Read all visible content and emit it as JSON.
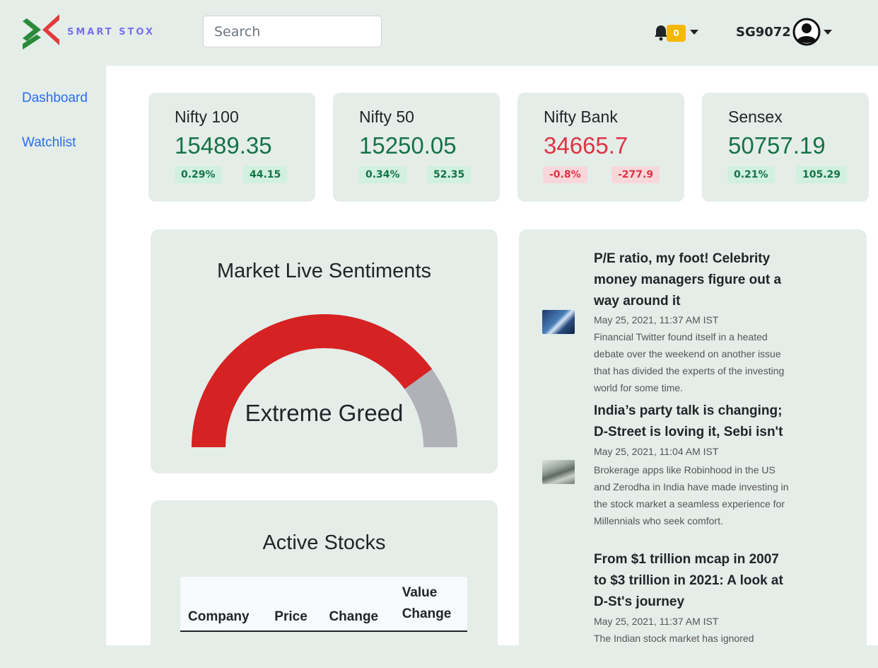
{
  "brand": {
    "name": "SMART STOX"
  },
  "search": {
    "placeholder": "Search"
  },
  "notifications": {
    "count": "0"
  },
  "user": {
    "name": "SG9072"
  },
  "sidebar": {
    "items": [
      {
        "label": "Dashboard"
      },
      {
        "label": "Watchlist"
      }
    ]
  },
  "indices": [
    {
      "name": "Nifty 100",
      "value": "15489.35",
      "change_pct": "0.29%",
      "change": "44.15",
      "direction": "up"
    },
    {
      "name": "Nifty 50",
      "value": "15250.05",
      "change_pct": "0.34%",
      "change": "52.35",
      "direction": "up"
    },
    {
      "name": "Nifty Bank",
      "value": "34665.7",
      "change_pct": "-0.8%",
      "change": "-277.9",
      "direction": "down"
    },
    {
      "name": "Sensex",
      "value": "50757.19",
      "change_pct": "0.21%",
      "change": "105.29",
      "direction": "up"
    }
  ],
  "sentiment": {
    "title": "Market Live Sentiments",
    "label": "Extreme Greed",
    "level": 0.8
  },
  "active_stocks": {
    "title": "Active Stocks",
    "columns": [
      "Company",
      "Price",
      "Change",
      "Value Change"
    ]
  },
  "news": [
    {
      "title": "P/E ratio, my foot! Celebrity money managers figure out a way around it",
      "time": "May 25, 2021, 11:37 AM IST",
      "description": "Financial Twitter found itself in a heated debate over the weekend on another issue that has divided the experts of the investing world for some time."
    },
    {
      "title": "India’s party talk is changing; D-Street is loving it, Sebi isn't",
      "time": "May 25, 2021, 11:04 AM IST",
      "description": "Brokerage apps like Robinhood in the US and Zerodha in India have made investing in the stock market a seamless experience for Millennials who seek comfort."
    },
    {
      "title": "From $1 trillion mcap in 2007 to $3 trillion in 2021: A look at D-St's journey",
      "time": "May 25, 2021, 11:37 AM IST",
      "description": "The Indian stock market has ignored"
    }
  ],
  "colors": {
    "positive": "#157347",
    "negative": "#dc3545",
    "gauge_fill": "#d62222",
    "gauge_track": "#b1b1b8",
    "accent": "#7a6ff0"
  }
}
